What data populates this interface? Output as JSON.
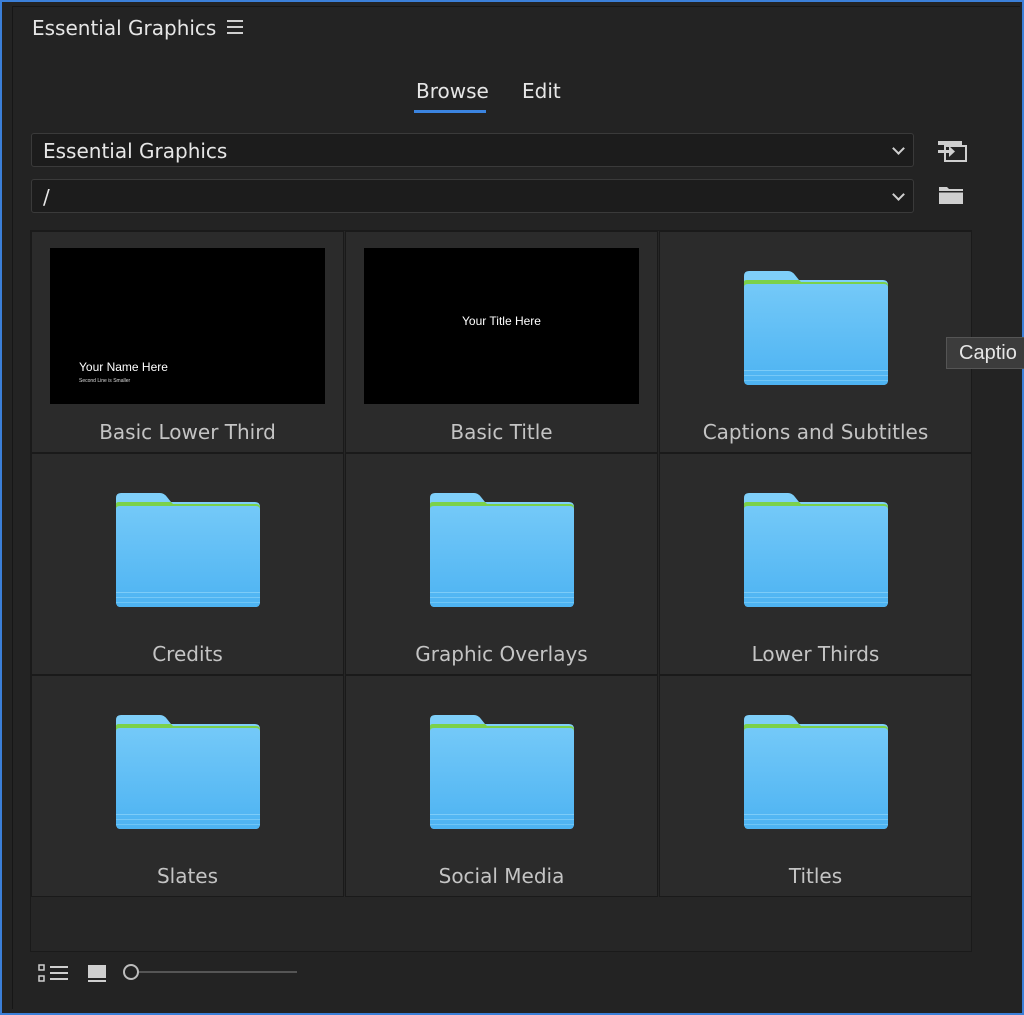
{
  "panel": {
    "title": "Essential Graphics",
    "menu_icon": "hamburger-menu-icon"
  },
  "tabs": [
    {
      "label": "Browse",
      "active": true
    },
    {
      "label": "Edit",
      "active": false
    }
  ],
  "library_dropdown": {
    "value": "Essential Graphics"
  },
  "path_dropdown": {
    "value": "/"
  },
  "side_icons": [
    "import-to-timeline-icon",
    "folder-icon"
  ],
  "items": [
    {
      "label": "Basic Lower Third",
      "type": "template",
      "thumb_line1": "Your Name Here",
      "thumb_line2": "Second Line is Smaller"
    },
    {
      "label": "Basic Title",
      "type": "template",
      "thumb_line1": "Your Title Here"
    },
    {
      "label": "Captions and Subtitles",
      "type": "folder"
    },
    {
      "label": "Credits",
      "type": "folder"
    },
    {
      "label": "Graphic Overlays",
      "type": "folder"
    },
    {
      "label": "Lower Thirds",
      "type": "folder"
    },
    {
      "label": "Slates",
      "type": "folder"
    },
    {
      "label": "Social Media",
      "type": "folder"
    },
    {
      "label": "Titles",
      "type": "folder"
    }
  ],
  "tooltip": {
    "text": "Captio"
  },
  "footer": {
    "icons": [
      "list-view-icon",
      "thumbnail-view-icon"
    ],
    "zoom_slider_value": 0
  },
  "colors": {
    "accent": "#3b84e0",
    "folder_blue": "#5cbdf5",
    "folder_tab_green": "#7bd14a",
    "panel_bg": "#232323"
  }
}
